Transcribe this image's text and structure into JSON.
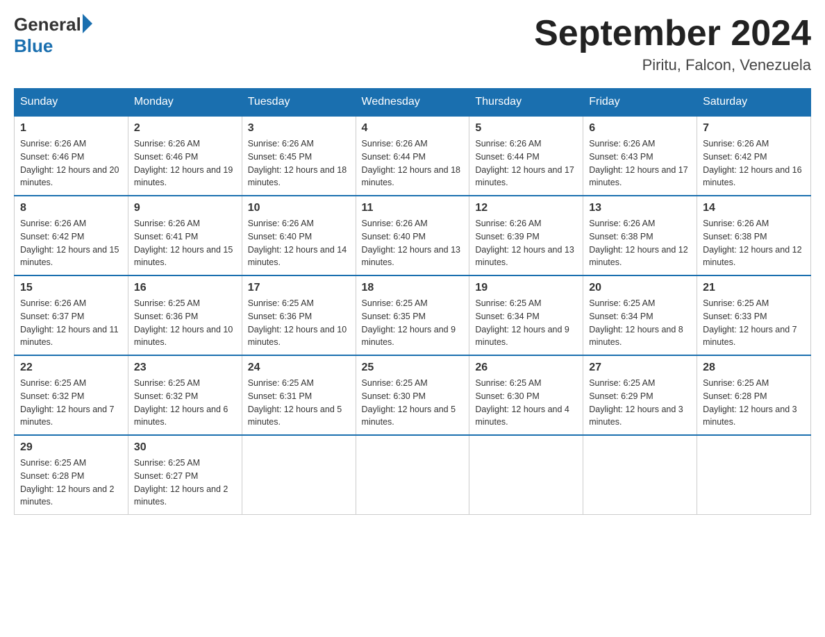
{
  "header": {
    "logo_general": "General",
    "logo_blue": "Blue",
    "month_title": "September 2024",
    "location": "Piritu, Falcon, Venezuela"
  },
  "weekdays": [
    "Sunday",
    "Monday",
    "Tuesday",
    "Wednesday",
    "Thursday",
    "Friday",
    "Saturday"
  ],
  "weeks": [
    [
      {
        "day": "1",
        "sunrise": "6:26 AM",
        "sunset": "6:46 PM",
        "daylight": "12 hours and 20 minutes."
      },
      {
        "day": "2",
        "sunrise": "6:26 AM",
        "sunset": "6:46 PM",
        "daylight": "12 hours and 19 minutes."
      },
      {
        "day": "3",
        "sunrise": "6:26 AM",
        "sunset": "6:45 PM",
        "daylight": "12 hours and 18 minutes."
      },
      {
        "day": "4",
        "sunrise": "6:26 AM",
        "sunset": "6:44 PM",
        "daylight": "12 hours and 18 minutes."
      },
      {
        "day": "5",
        "sunrise": "6:26 AM",
        "sunset": "6:44 PM",
        "daylight": "12 hours and 17 minutes."
      },
      {
        "day": "6",
        "sunrise": "6:26 AM",
        "sunset": "6:43 PM",
        "daylight": "12 hours and 17 minutes."
      },
      {
        "day": "7",
        "sunrise": "6:26 AM",
        "sunset": "6:42 PM",
        "daylight": "12 hours and 16 minutes."
      }
    ],
    [
      {
        "day": "8",
        "sunrise": "6:26 AM",
        "sunset": "6:42 PM",
        "daylight": "12 hours and 15 minutes."
      },
      {
        "day": "9",
        "sunrise": "6:26 AM",
        "sunset": "6:41 PM",
        "daylight": "12 hours and 15 minutes."
      },
      {
        "day": "10",
        "sunrise": "6:26 AM",
        "sunset": "6:40 PM",
        "daylight": "12 hours and 14 minutes."
      },
      {
        "day": "11",
        "sunrise": "6:26 AM",
        "sunset": "6:40 PM",
        "daylight": "12 hours and 13 minutes."
      },
      {
        "day": "12",
        "sunrise": "6:26 AM",
        "sunset": "6:39 PM",
        "daylight": "12 hours and 13 minutes."
      },
      {
        "day": "13",
        "sunrise": "6:26 AM",
        "sunset": "6:38 PM",
        "daylight": "12 hours and 12 minutes."
      },
      {
        "day": "14",
        "sunrise": "6:26 AM",
        "sunset": "6:38 PM",
        "daylight": "12 hours and 12 minutes."
      }
    ],
    [
      {
        "day": "15",
        "sunrise": "6:26 AM",
        "sunset": "6:37 PM",
        "daylight": "12 hours and 11 minutes."
      },
      {
        "day": "16",
        "sunrise": "6:25 AM",
        "sunset": "6:36 PM",
        "daylight": "12 hours and 10 minutes."
      },
      {
        "day": "17",
        "sunrise": "6:25 AM",
        "sunset": "6:36 PM",
        "daylight": "12 hours and 10 minutes."
      },
      {
        "day": "18",
        "sunrise": "6:25 AM",
        "sunset": "6:35 PM",
        "daylight": "12 hours and 9 minutes."
      },
      {
        "day": "19",
        "sunrise": "6:25 AM",
        "sunset": "6:34 PM",
        "daylight": "12 hours and 9 minutes."
      },
      {
        "day": "20",
        "sunrise": "6:25 AM",
        "sunset": "6:34 PM",
        "daylight": "12 hours and 8 minutes."
      },
      {
        "day": "21",
        "sunrise": "6:25 AM",
        "sunset": "6:33 PM",
        "daylight": "12 hours and 7 minutes."
      }
    ],
    [
      {
        "day": "22",
        "sunrise": "6:25 AM",
        "sunset": "6:32 PM",
        "daylight": "12 hours and 7 minutes."
      },
      {
        "day": "23",
        "sunrise": "6:25 AM",
        "sunset": "6:32 PM",
        "daylight": "12 hours and 6 minutes."
      },
      {
        "day": "24",
        "sunrise": "6:25 AM",
        "sunset": "6:31 PM",
        "daylight": "12 hours and 5 minutes."
      },
      {
        "day": "25",
        "sunrise": "6:25 AM",
        "sunset": "6:30 PM",
        "daylight": "12 hours and 5 minutes."
      },
      {
        "day": "26",
        "sunrise": "6:25 AM",
        "sunset": "6:30 PM",
        "daylight": "12 hours and 4 minutes."
      },
      {
        "day": "27",
        "sunrise": "6:25 AM",
        "sunset": "6:29 PM",
        "daylight": "12 hours and 3 minutes."
      },
      {
        "day": "28",
        "sunrise": "6:25 AM",
        "sunset": "6:28 PM",
        "daylight": "12 hours and 3 minutes."
      }
    ],
    [
      {
        "day": "29",
        "sunrise": "6:25 AM",
        "sunset": "6:28 PM",
        "daylight": "12 hours and 2 minutes."
      },
      {
        "day": "30",
        "sunrise": "6:25 AM",
        "sunset": "6:27 PM",
        "daylight": "12 hours and 2 minutes."
      },
      null,
      null,
      null,
      null,
      null
    ]
  ]
}
